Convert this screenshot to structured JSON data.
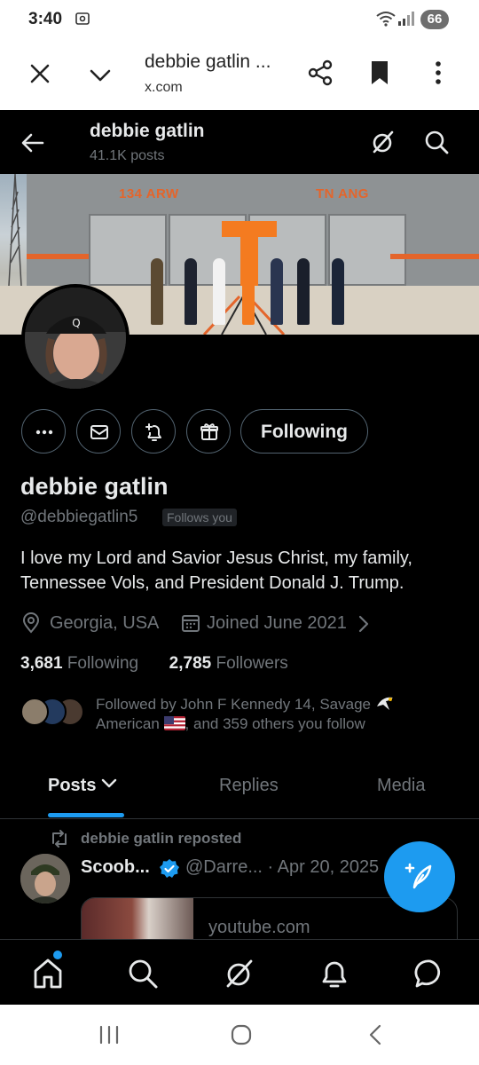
{
  "status_bar": {
    "time": "3:40",
    "battery": "66"
  },
  "browser": {
    "page_title": "debbie gatlin ...",
    "url": "x.com"
  },
  "header": {
    "name": "debbie gatlin",
    "posts": "41.1K posts"
  },
  "banner": {
    "left_text": "134 ARW",
    "right_text": "TN ANG"
  },
  "actions": {
    "following_label": "Following"
  },
  "profile": {
    "name": "debbie gatlin",
    "handle": "@debbiegatlin5",
    "follows_you": "Follows you",
    "bio": "I love my Lord and Savior Jesus Christ, my family, Tennessee Vols, and President Donald J. Trump.",
    "location": "Georgia, USA",
    "joined": "Joined June 2021",
    "following_count": "3,681",
    "following_label": "Following",
    "followers_count": "2,785",
    "followers_label": "Followers",
    "followed_by_a": "Followed by John F Kennedy 14, Savage",
    "followed_by_b": "American",
    "followed_by_c": ", and 359 others you follow"
  },
  "tabs": [
    {
      "label": "Posts"
    },
    {
      "label": "Replies"
    },
    {
      "label": "Media"
    }
  ],
  "post": {
    "repost_label": "debbie gatlin reposted",
    "author": "Scoob...",
    "meta": "@Darre... · Apr 20, 2025",
    "link_domain": "youtube.com"
  },
  "colors": {
    "accent": "#1d9bf0",
    "muted": "#71767b",
    "text": "#e7e9ea",
    "border": "#2f3336"
  }
}
